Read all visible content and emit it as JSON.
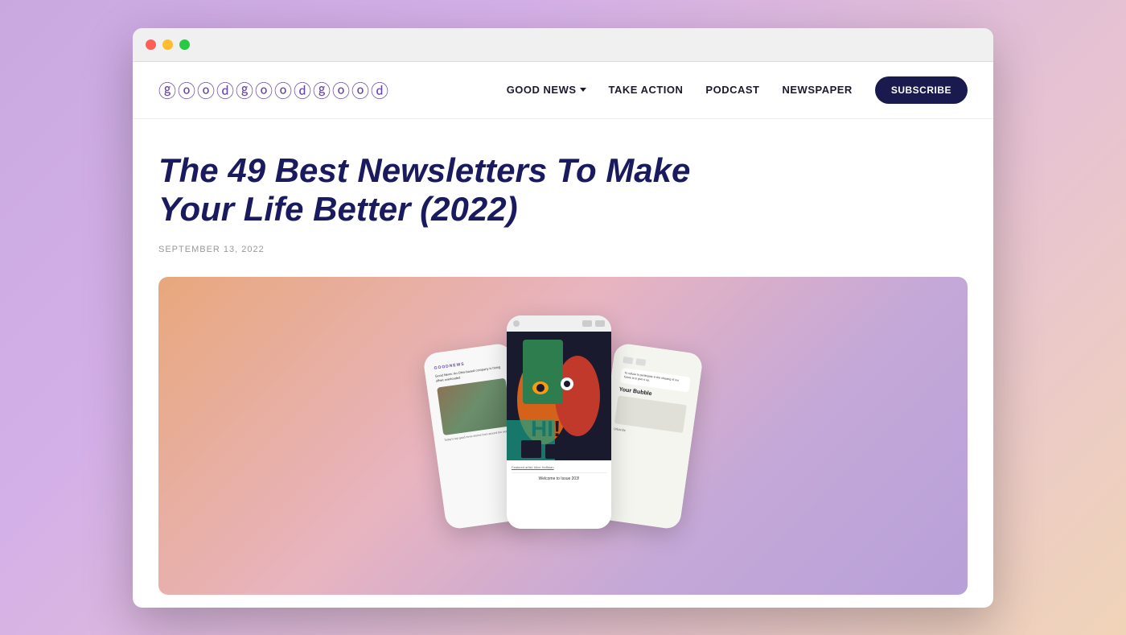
{
  "browser": {
    "traffic_lights": [
      "red",
      "yellow",
      "green"
    ]
  },
  "navbar": {
    "logo": "GOODGOODGOOD",
    "logo_display": "ⓖⓞⓞⓓⓖⓞⓞⓓⓖⓞⓞⓓ",
    "links": [
      {
        "id": "good-news",
        "label": "GOOD NEWS",
        "has_dropdown": true
      },
      {
        "id": "take-action",
        "label": "TAKE ACTION",
        "has_dropdown": false
      },
      {
        "id": "podcast",
        "label": "PODCAST",
        "has_dropdown": false
      },
      {
        "id": "newspaper",
        "label": "NEWSPAPER",
        "has_dropdown": false
      }
    ],
    "subscribe_label": "SUBSCRIBE"
  },
  "article": {
    "title": "The 49 Best Newsletters To Make Your Life Better (2022)",
    "date": "SEPTEMBER 13, 2022"
  },
  "hero": {
    "alt": "Newsletter mockups on phone screens"
  },
  "phones": {
    "left": {
      "header": "GOODNEWS",
      "content": "Good News: An Ohio-based company is hiring offset overloaded",
      "subtext": "Today's top good news stories from around the world"
    },
    "center": {
      "caption": "Featured artist: Alice Hoffman",
      "bottom_text": "Welcome to Issue 203!",
      "illustration_desc": "Colorful face illustration with geometric shapes"
    },
    "right": {
      "title": "Your Bubble",
      "subtitle": "Urbanite",
      "quote": "To refuse to participate in the shaping of our future is to give it up."
    }
  }
}
